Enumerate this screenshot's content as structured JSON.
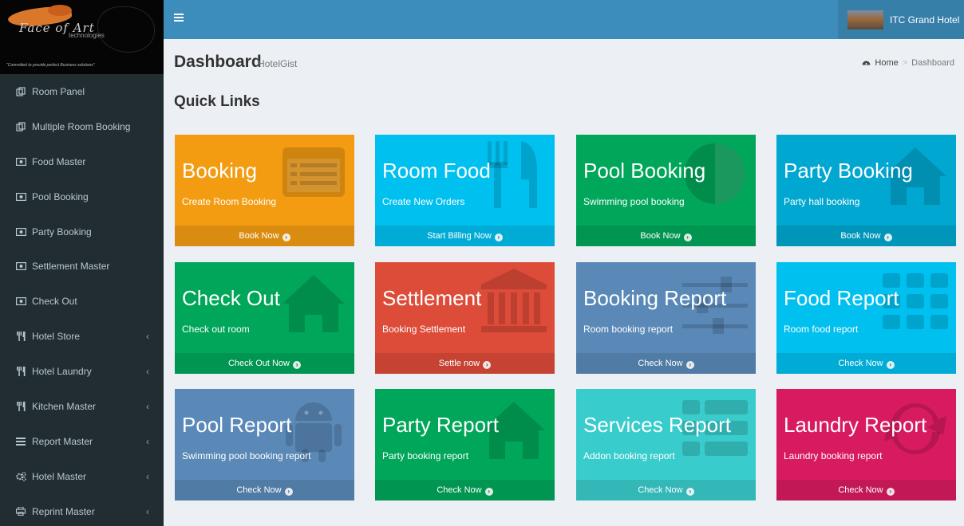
{
  "sidebar": {
    "logo": {
      "name": "Face of Art",
      "subtext": "technologies",
      "tagline": "\"Committed to provide perfect Business solutions\""
    },
    "items": [
      {
        "label": "Room Panel",
        "icon": "rooms-icon",
        "submenu": false
      },
      {
        "label": "Multiple Room Booking",
        "icon": "rooms-icon",
        "submenu": false
      },
      {
        "label": "Food Master",
        "icon": "money-icon",
        "submenu": false
      },
      {
        "label": "Pool Booking",
        "icon": "money-icon",
        "submenu": false
      },
      {
        "label": "Party Booking",
        "icon": "money-icon",
        "submenu": false
      },
      {
        "label": "Settlement Master",
        "icon": "money-icon",
        "submenu": false
      },
      {
        "label": "Check Out",
        "icon": "money-icon",
        "submenu": false
      },
      {
        "label": "Hotel Store",
        "icon": "cutlery-icon",
        "submenu": true
      },
      {
        "label": "Hotel Laundry",
        "icon": "cutlery-icon",
        "submenu": true
      },
      {
        "label": "Kitchen Master",
        "icon": "cutlery-icon",
        "submenu": true
      },
      {
        "label": "Report Master",
        "icon": "list-icon",
        "submenu": true
      },
      {
        "label": "Hotel Master",
        "icon": "gears-icon",
        "submenu": true
      },
      {
        "label": "Reprint Master",
        "icon": "print-icon",
        "submenu": true
      }
    ]
  },
  "header": {
    "menu_icon": "hamburger-icon",
    "user_name": "ITC Grand Hotel"
  },
  "content": {
    "title": "Dashboard",
    "subtitle": "HotelGist",
    "breadcrumb": {
      "home": "Home",
      "current": "Dashboard"
    },
    "section_title": "Quick Links"
  },
  "tiles": [
    {
      "title": "Booking",
      "subtitle": "Create Room Booking",
      "footer": "Book Now",
      "icon": "calendar-list-icon",
      "color": "#f39c12"
    },
    {
      "title": "Room Food",
      "subtitle": "Create New Orders",
      "footer": "Start Billing Now",
      "icon": "cutlery-icon",
      "color": "#00c0ef"
    },
    {
      "title": "Pool Booking",
      "subtitle": "Swimming pool booking",
      "footer": "Book Now",
      "icon": "half-circle-icon",
      "color": "#00a65a"
    },
    {
      "title": "Party Booking",
      "subtitle": "Party hall booking",
      "footer": "Book Now",
      "icon": "home-icon",
      "color": "#00a7d0"
    },
    {
      "title": "Check Out",
      "subtitle": "Check out room",
      "footer": "Check Out Now",
      "icon": "home-icon",
      "color": "#00a65a"
    },
    {
      "title": "Settlement",
      "subtitle": "Booking Settlement",
      "footer": "Settle now",
      "icon": "bank-icon",
      "color": "#dd4b39"
    },
    {
      "title": "Booking Report",
      "subtitle": "Room booking report",
      "footer": "Check Now",
      "icon": "sliders-icon",
      "color": "#5a89b8"
    },
    {
      "title": "Food Report",
      "subtitle": "Room food report",
      "footer": "Check Now",
      "icon": "grid-icon",
      "color": "#00c0ef"
    },
    {
      "title": "Pool Report",
      "subtitle": "Swimming pool booking report",
      "footer": "Check Now",
      "icon": "android-icon",
      "color": "#5a89b8"
    },
    {
      "title": "Party Report",
      "subtitle": "Party booking report",
      "footer": "Check Now",
      "icon": "home-icon",
      "color": "#00a65a"
    },
    {
      "title": "Services Report",
      "subtitle": "Addon booking report",
      "footer": "Check Now",
      "icon": "th-list-icon",
      "color": "#39cccc"
    },
    {
      "title": "Laundry Report",
      "subtitle": "Laundry booking report",
      "footer": "Check Now",
      "icon": "refresh-icon",
      "color": "#d81b60"
    }
  ]
}
